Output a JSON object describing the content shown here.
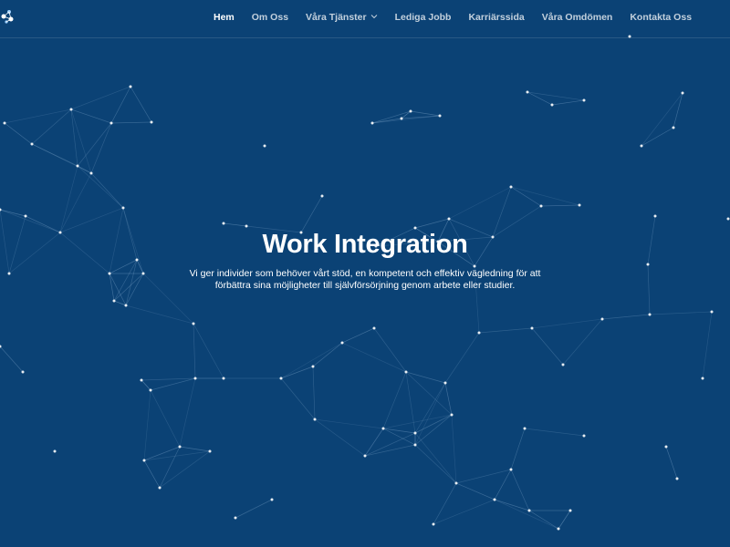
{
  "header": {
    "logo_icon": "network-logo-icon",
    "nav": [
      {
        "label": "Hem",
        "active": true
      },
      {
        "label": "Om Oss",
        "active": false
      },
      {
        "label": "Våra Tjänster",
        "active": false,
        "dropdown": true
      },
      {
        "label": "Lediga Jobb",
        "active": false
      },
      {
        "label": "Karriärssida",
        "active": false
      },
      {
        "label": "Våra Omdömen",
        "active": false
      },
      {
        "label": "Kontakta Oss",
        "active": false
      }
    ]
  },
  "hero": {
    "title": "Work Integration",
    "description": "Vi ger individer som behöver vårt stöd, en kompetent och effektiv vägledning för att förbättra sina möjligheter till självförsörjning genom arbete eller studier."
  },
  "colors": {
    "background": "#0b4275",
    "text": "#ffffff",
    "network_lines": "#8fb4d6",
    "network_nodes": "#ffffff"
  }
}
